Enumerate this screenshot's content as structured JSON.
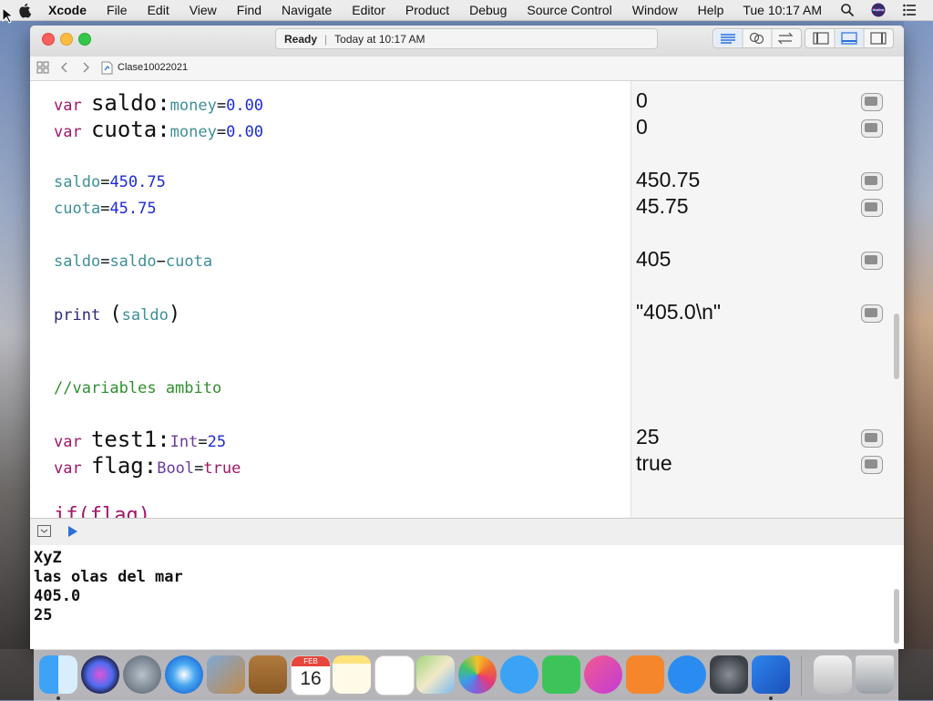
{
  "menubar": {
    "app_name": "Xcode",
    "items": [
      "File",
      "Edit",
      "View",
      "Find",
      "Navigate",
      "Editor",
      "Product",
      "Debug",
      "Source Control",
      "Window",
      "Help"
    ],
    "clock": "Tue 10:17 AM"
  },
  "window": {
    "status": {
      "state": "Ready",
      "time": "Today at 10:17 AM"
    },
    "jumpbar": {
      "file_name": "Clase10022021"
    }
  },
  "editor": {
    "lines": [
      {
        "kw": "var ",
        "name": "saldo:",
        "type": "money",
        "op": "=",
        "val": "0.00"
      },
      {
        "kw": "var ",
        "name": "cuota:",
        "type": "money",
        "op": "=",
        "val": "0.00"
      },
      {
        "a": "saldo",
        "op": "=",
        "b": "450.75"
      },
      {
        "a": "cuota",
        "op": "=",
        "b": "45.75"
      },
      {
        "a": "saldo",
        "op": "=",
        "b": "saldo",
        "op2": "−",
        "c": "cuota"
      },
      {
        "fn": "print ",
        "p1": "(",
        "arg": "saldo",
        "p2": ")"
      },
      {
        "comment": "//variables ambito"
      },
      {
        "kw": "var ",
        "name": "test1:",
        "type": "Int",
        "op": "=",
        "val": "25"
      },
      {
        "kw": "var ",
        "name": "flag:",
        "type": "Bool",
        "op": "=",
        "val": "true"
      },
      {
        "partial": "if(flag)"
      }
    ],
    "results": [
      "0",
      "0",
      "450.75",
      "45.75",
      "405",
      "\"405.0\\n\"",
      "25",
      "true"
    ]
  },
  "console": {
    "lines": [
      "XyZ",
      "las olas del mar",
      "405.0",
      "25"
    ]
  },
  "colors": {
    "keyword": "#a0176a",
    "type": "#6a3b9e",
    "number": "#1c2bd6",
    "identifier": "#3e8f98",
    "comment": "#2f8f2f"
  },
  "dock": {
    "icons": [
      "finder-icon",
      "siri-icon",
      "launchpad-icon",
      "safari-icon",
      "photo-preview-icon",
      "contacts-icon",
      "calendar-icon",
      "notes-icon",
      "reminders-icon",
      "maps-icon",
      "photos-icon",
      "messages-icon",
      "facetime-icon",
      "itunes-icon",
      "ibooks-icon",
      "app-store-icon",
      "system-preferences-icon",
      "xcode-icon",
      "disk-icon",
      "trash-icon"
    ],
    "calendar": {
      "month": "FEB",
      "day": "16"
    }
  }
}
